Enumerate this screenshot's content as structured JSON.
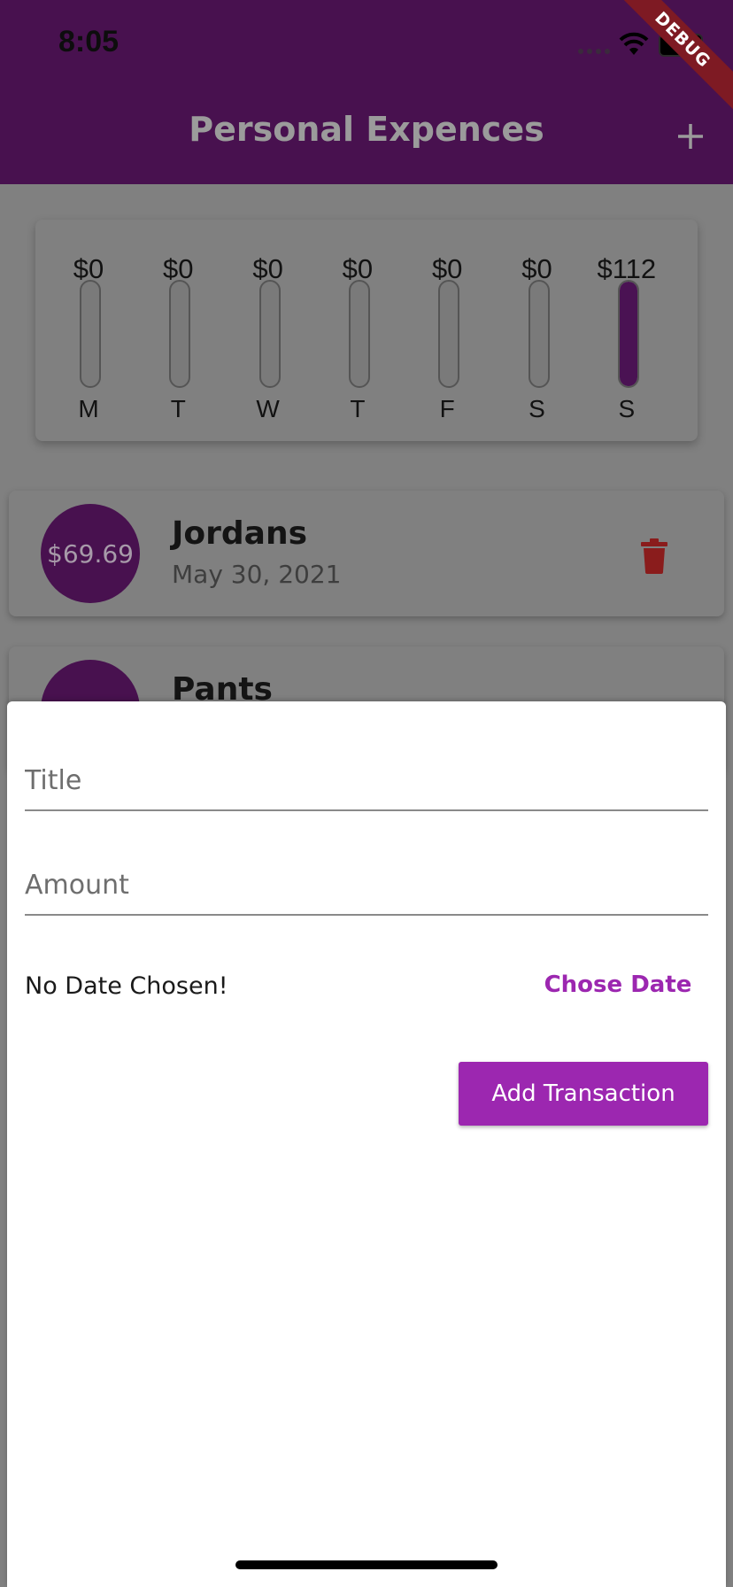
{
  "status_bar": {
    "time": "8:05"
  },
  "debug_banner": "DEBUG",
  "app_bar": {
    "title": "Personal Expences",
    "add_icon": "plus-icon"
  },
  "colors": {
    "primary": "#9c27b0",
    "primary_dim": "#48114f",
    "delete": "#8a1c1c"
  },
  "chart": {
    "bars": [
      {
        "day": "M",
        "amount": "$0",
        "fraction": 0
      },
      {
        "day": "T",
        "amount": "$0",
        "fraction": 0
      },
      {
        "day": "W",
        "amount": "$0",
        "fraction": 0
      },
      {
        "day": "T",
        "amount": "$0",
        "fraction": 0
      },
      {
        "day": "F",
        "amount": "$0",
        "fraction": 0
      },
      {
        "day": "S",
        "amount": "$0",
        "fraction": 0
      },
      {
        "day": "S",
        "amount": "$112",
        "fraction": 1
      }
    ]
  },
  "transactions": [
    {
      "amount": "$69.69",
      "title": "Jordans",
      "date": "May 30, 2021"
    },
    {
      "amount": "",
      "title": "Pants",
      "date": ""
    }
  ],
  "form": {
    "title_placeholder": "Title",
    "amount_placeholder": "Amount",
    "date_status": "No Date Chosen!",
    "choose_date_label": "Chose Date",
    "submit_label": "Add Transaction"
  }
}
